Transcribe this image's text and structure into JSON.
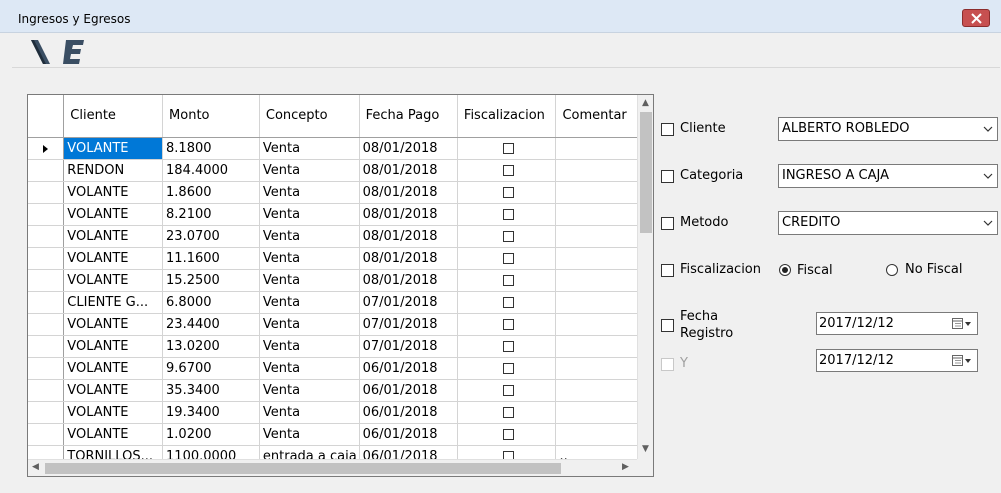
{
  "window": {
    "title": "Ingresos y Egresos"
  },
  "toolbar": {
    "income_icon": "I-icon",
    "expense_icon": "E-icon"
  },
  "grid": {
    "columns": [
      "Cliente",
      "Monto",
      "Concepto",
      "Fecha Pago",
      "Fiscalizacion",
      "Comentar"
    ],
    "rows": [
      {
        "cliente": "VOLANTE",
        "monto": "8.1800",
        "concepto": "Venta",
        "fecha": "08/01/2018"
      },
      {
        "cliente": "RENDON",
        "monto": "184.4000",
        "concepto": "Venta",
        "fecha": "08/01/2018"
      },
      {
        "cliente": "VOLANTE",
        "monto": "1.8600",
        "concepto": "Venta",
        "fecha": "08/01/2018"
      },
      {
        "cliente": "VOLANTE",
        "monto": "8.2100",
        "concepto": "Venta",
        "fecha": "08/01/2018"
      },
      {
        "cliente": "VOLANTE",
        "monto": "23.0700",
        "concepto": "Venta",
        "fecha": "08/01/2018"
      },
      {
        "cliente": "VOLANTE",
        "monto": "11.1600",
        "concepto": "Venta",
        "fecha": "08/01/2018"
      },
      {
        "cliente": "VOLANTE",
        "monto": "15.2500",
        "concepto": "Venta",
        "fecha": "08/01/2018"
      },
      {
        "cliente": "CLIENTE G...",
        "monto": "6.8000",
        "concepto": "Venta",
        "fecha": "07/01/2018"
      },
      {
        "cliente": "VOLANTE",
        "monto": "23.4400",
        "concepto": "Venta",
        "fecha": "07/01/2018"
      },
      {
        "cliente": "VOLANTE",
        "monto": "13.0200",
        "concepto": "Venta",
        "fecha": "07/01/2018"
      },
      {
        "cliente": "VOLANTE",
        "monto": "9.6700",
        "concepto": "Venta",
        "fecha": "06/01/2018"
      },
      {
        "cliente": "VOLANTE",
        "monto": "35.3400",
        "concepto": "Venta",
        "fecha": "06/01/2018"
      },
      {
        "cliente": "VOLANTE",
        "monto": "19.3400",
        "concepto": "Venta",
        "fecha": "06/01/2018"
      },
      {
        "cliente": "VOLANTE",
        "monto": "1.0200",
        "concepto": "Venta",
        "fecha": "06/01/2018"
      },
      {
        "cliente": "TORNILLOS...",
        "monto": "1100.0000",
        "concepto": "entrada a caja",
        "fecha": "06/01/2018",
        "comentario": ".."
      }
    ]
  },
  "filters": {
    "cliente": {
      "label": "Cliente",
      "value": "ALBERTO ROBLEDO"
    },
    "categoria": {
      "label": "Categoria",
      "value": "INGRESO A CAJA"
    },
    "metodo": {
      "label": "Metodo",
      "value": "CREDITO"
    },
    "fiscalizacion": {
      "label": "Fiscalizacion",
      "opt_fiscal": "Fiscal",
      "opt_no_fiscal": "No Fiscal"
    },
    "fecha_registro": {
      "label_line1": "Fecha",
      "label_line2": "Registro",
      "value": "2017/12/12"
    },
    "y": {
      "label": "Y",
      "value": "2017/12/12"
    }
  }
}
